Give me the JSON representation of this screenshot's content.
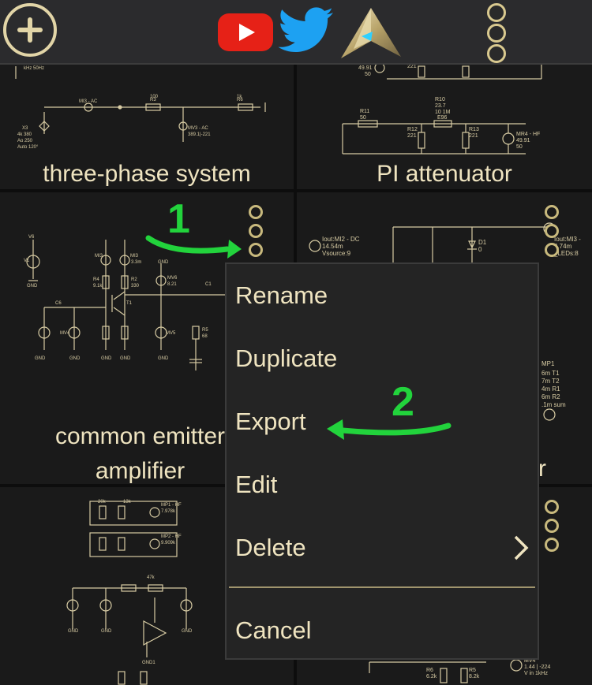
{
  "topbar": {
    "add_icon": "plus-circle-icon",
    "youtube_icon": "youtube-icon",
    "twitter_icon": "twitter-icon",
    "app_icon": "delta-wing-logo-icon",
    "more_icon": "vertical-dots-icon"
  },
  "projects": [
    {
      "title": "three-phase system"
    },
    {
      "title": "PI attenuator"
    },
    {
      "title": "common emitter\namplifier"
    },
    {
      "title": "r"
    }
  ],
  "context_menu": {
    "items": [
      "Rename",
      "Duplicate",
      "Export",
      "Edit",
      "Delete",
      "Cancel"
    ]
  },
  "annotations": {
    "step1": "1",
    "step2": "2",
    "color": "#22d33c"
  },
  "schematic_labels": {
    "pi_r10": "R10",
    "pi_r10_val": "23.7",
    "pi_r10_tol": "10 1M",
    "pi_r10_series": "E96",
    "pi_r11": "R11",
    "pi_r11_val": "50",
    "pi_r12": "R12",
    "pi_r12_val": "221",
    "pi_r13": "R13",
    "pi_r13_val": "221",
    "pi_meter": "MR4 - HF",
    "pi_meter_val": "49.91",
    "pi_meter_sub": "50",
    "pi_top_meter_val": "49.91",
    "pi_top_meter_sub": "50",
    "pi_top_r_val": "221",
    "ce_meter": "Iout:MI2 - DC",
    "ce_meter_val": "14.54m",
    "ce_vsource": "Vsource:9",
    "ce_d1": "D1",
    "ce_d1_val": "0",
    "right_meter": "Iout:MI3 -",
    "right_meter_val": "4.74m",
    "right_leds": "_LEDs:8",
    "right_mp": "MP1",
    "right_rows": [
      "6m  T1",
      "7m  T2",
      "4m  R1",
      "6m  R2"
    ],
    "right_sum": ".1m   sum",
    "bottom_meter1": "MP1 - HF",
    "bottom_meter1_val": "7.978k",
    "bottom_meter2": "MP2 - HF",
    "bottom_meter2_val": "9.909k",
    "bottom_r_a": "20k",
    "bottom_r_b": "13k",
    "bottom_r_c": "47k",
    "bottom_right_meter": "MV4",
    "bottom_right_val": "1.44 | -224",
    "bottom_right_sub": "V in 1kHz",
    "bottom_r5": "R5",
    "bottom_r5_val": "8.2k",
    "bottom_r6": "R6",
    "bottom_r6_val": "6.2k"
  }
}
